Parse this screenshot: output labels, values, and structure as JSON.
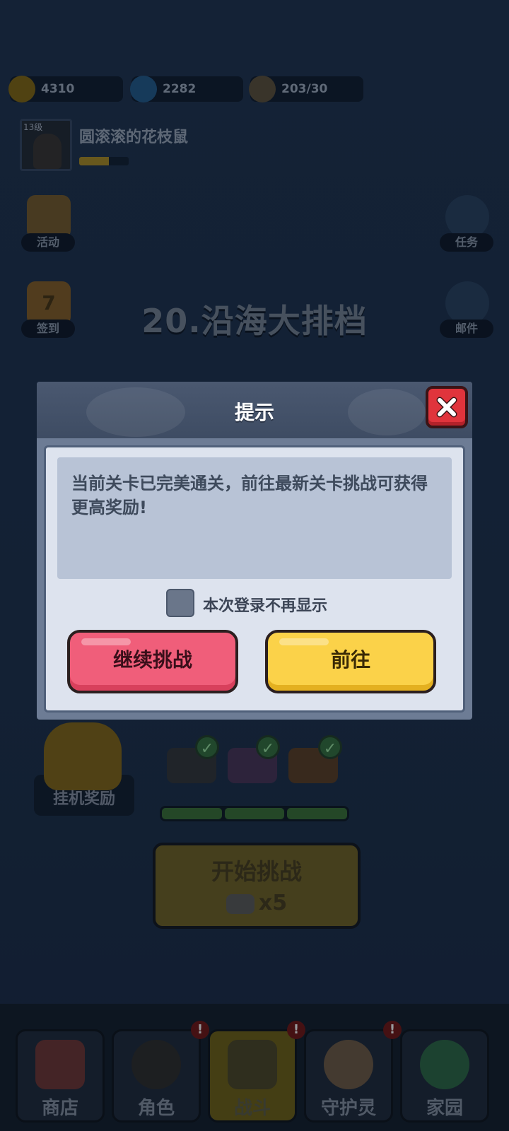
{
  "top_bar": {
    "currencies": [
      {
        "icon": "paw-coin-icon",
        "value": "4310"
      },
      {
        "icon": "blue-gem-icon",
        "value": "2282"
      },
      {
        "icon": "energy-can-icon",
        "value": "203/30"
      }
    ]
  },
  "player": {
    "level": "13级",
    "name": "圆滚滚的花枝鼠",
    "xp_fraction": 0.6
  },
  "side_buttons": {
    "activity": "活动",
    "checkin": "签到",
    "checkin_day": "7",
    "tasks": "任务",
    "mail": "邮件"
  },
  "stage": {
    "title": "20.沿海大排档"
  },
  "idle": {
    "label": "挂机奖励",
    "progress_segments": 3
  },
  "start": {
    "label": "开始挑战",
    "cost": "x5"
  },
  "bottom_nav": [
    {
      "label": "商店",
      "icon": "shop-icon",
      "alert": false
    },
    {
      "label": "角色",
      "icon": "character-icon",
      "alert": true
    },
    {
      "label": "战斗",
      "icon": "battle-icon",
      "alert": true,
      "active": true
    },
    {
      "label": "守护灵",
      "icon": "guardian-icon",
      "alert": true
    },
    {
      "label": "家园",
      "icon": "home-globe-icon",
      "alert": false
    }
  ],
  "dialog": {
    "title": "提示",
    "message": "当前关卡已完美通关，前往最新关卡挑战可获得更高奖励!",
    "checkbox_label": "本次登录不再显示",
    "checkbox_checked": false,
    "continue_label": "继续挑战",
    "go_label": "前往",
    "alert_mark": "!",
    "check_mark": "✓"
  },
  "colors": {
    "dialog_header": "#4a5870",
    "dialog_body": "#dde3ee",
    "continue_button": "#f05e7a",
    "go_button": "#fbd249",
    "close_button": "#e0343c"
  }
}
